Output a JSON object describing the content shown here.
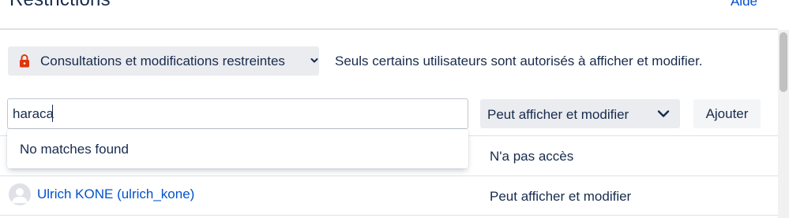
{
  "header": {
    "title": "Restrictions",
    "help_label": "Aide"
  },
  "restriction": {
    "selected": "Consultations et modifications restreintes",
    "icon": "lock-icon",
    "description": "Seuls certains utilisateurs sont autorisés à afficher et modifier."
  },
  "search": {
    "value": "haraca",
    "placeholder": ""
  },
  "permission": {
    "selected": "Peut afficher et modifier"
  },
  "add_button": {
    "label": "Ajouter"
  },
  "dropdown": {
    "message": "No matches found"
  },
  "rows": [
    {
      "user": "",
      "permission": "N'a pas accès"
    },
    {
      "user": "Ulrich KONE (ulrich_kone)",
      "permission": "Peut afficher et modifier"
    }
  ],
  "colors": {
    "link": "#0052cc",
    "text": "#172b4d",
    "lock": "#de350b",
    "select_bg": "#ebecf0"
  }
}
